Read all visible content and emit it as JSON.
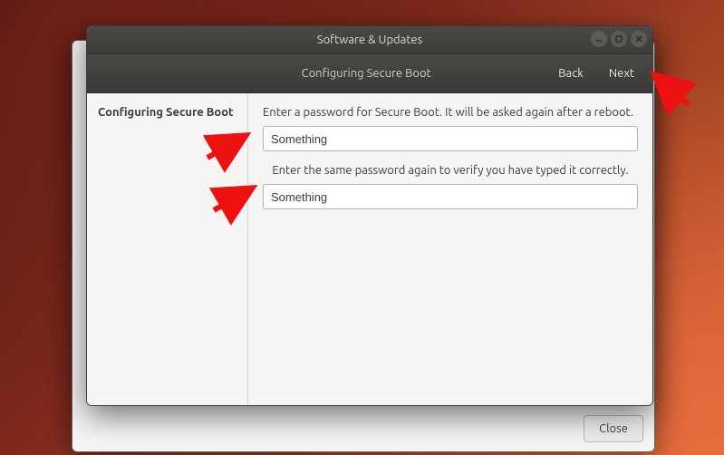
{
  "window": {
    "title": "Software & Updates",
    "subtitle": "Configuring Secure Boot",
    "back_label": "Back",
    "next_label": "Next"
  },
  "sidebar": {
    "step_label": "Configuring Secure Boot"
  },
  "main": {
    "instruction_primary": "Enter a password for Secure Boot. It will be asked again after a reboot.",
    "password_value": "Something",
    "instruction_confirm": "Enter the same password again to verify you have typed it correctly.",
    "password_confirm_value": "Something"
  },
  "background_dialog": {
    "close_label": "Close"
  }
}
